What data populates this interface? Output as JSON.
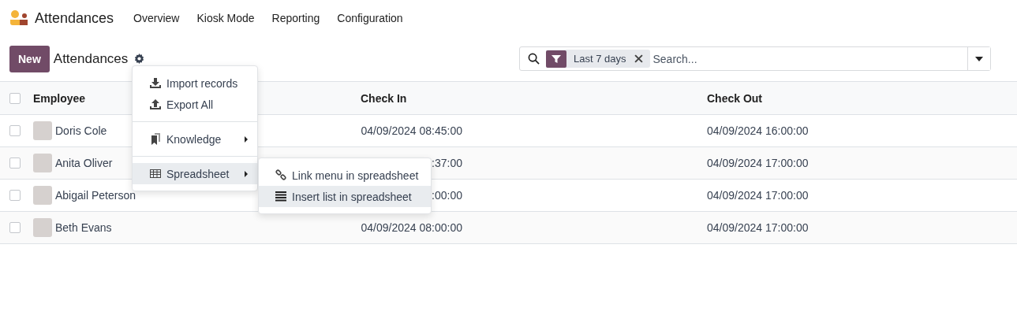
{
  "navbar": {
    "app_name": "Attendances",
    "menu": [
      "Overview",
      "Kiosk Mode",
      "Reporting",
      "Configuration"
    ]
  },
  "control_panel": {
    "new_button": "New",
    "breadcrumb": "Attendances",
    "search": {
      "facet": "Last 7 days",
      "placeholder": "Search..."
    }
  },
  "actions_menu": {
    "items": [
      {
        "kind": "action",
        "label": "Import records",
        "selected": false
      },
      {
        "kind": "action",
        "label": "Export All",
        "selected": false
      },
      {
        "kind": "divider"
      },
      {
        "kind": "submenu",
        "label": "Knowledge",
        "selected": false
      },
      {
        "kind": "divider"
      },
      {
        "kind": "submenu",
        "label": "Spreadsheet",
        "selected": true
      }
    ]
  },
  "submenu": {
    "items": [
      {
        "label": "Link menu in spreadsheet",
        "selected": false
      },
      {
        "label": "Insert list in spreadsheet",
        "selected": true
      }
    ]
  },
  "table": {
    "select_all_checked": false,
    "columns": [
      "Employee",
      "Check In",
      "Check Out"
    ],
    "rows": [
      {
        "employee": "Doris Cole",
        "check_in": "04/09/2024 08:45:00",
        "check_out": "04/09/2024 16:00:00",
        "checked": false
      },
      {
        "employee": "Anita Oliver",
        "check_in": ":37:00",
        "check_out": "04/09/2024 17:00:00",
        "checked": false
      },
      {
        "employee": "Abigail Peterson",
        "check_in": ":00:00",
        "check_out": "04/09/2024 17:00:00",
        "checked": false
      },
      {
        "employee": "Beth Evans",
        "check_in": "04/09/2024 08:00:00",
        "check_out": "04/09/2024 17:00:00",
        "checked": false
      }
    ]
  }
}
